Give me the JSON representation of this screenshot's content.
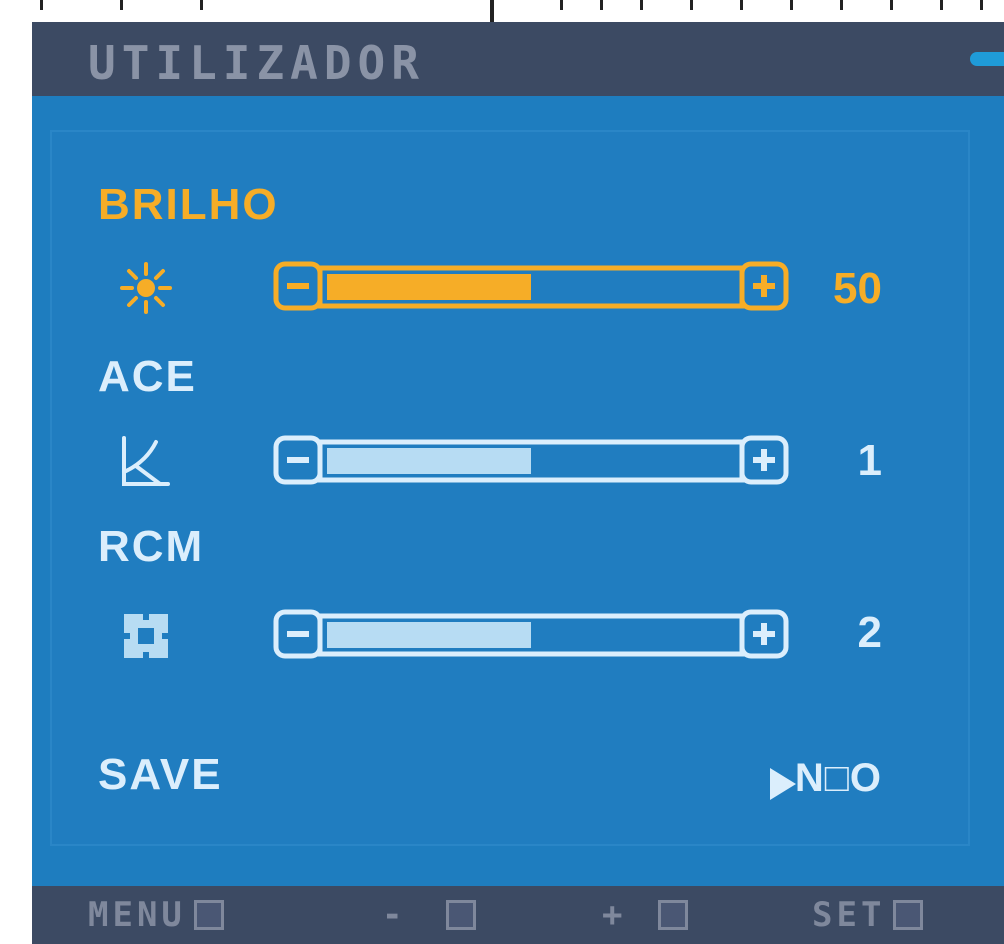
{
  "header": {
    "title": "UTILIZADOR"
  },
  "controls": [
    {
      "label": "BRILHO",
      "icon": "sun-icon",
      "value": "50",
      "level": 0.5,
      "active": true
    },
    {
      "label": "ACE",
      "icon": "contrast-curve-icon",
      "value": "1",
      "level": 0.5,
      "active": false
    },
    {
      "label": "RCM",
      "icon": "color-management-icon",
      "value": "2",
      "level": 0.5,
      "active": false
    }
  ],
  "save": {
    "label": "SAVE",
    "value": "N□O"
  },
  "footer": {
    "menu": "MENU",
    "minus": "-",
    "plus": "+",
    "set": "SET"
  },
  "colors": {
    "background": "#1e7dbf",
    "bar": "#3c4a63",
    "active": "#f6ad27",
    "inactive": "#dbeefc",
    "fill_inactive": "#b7dcf3"
  }
}
